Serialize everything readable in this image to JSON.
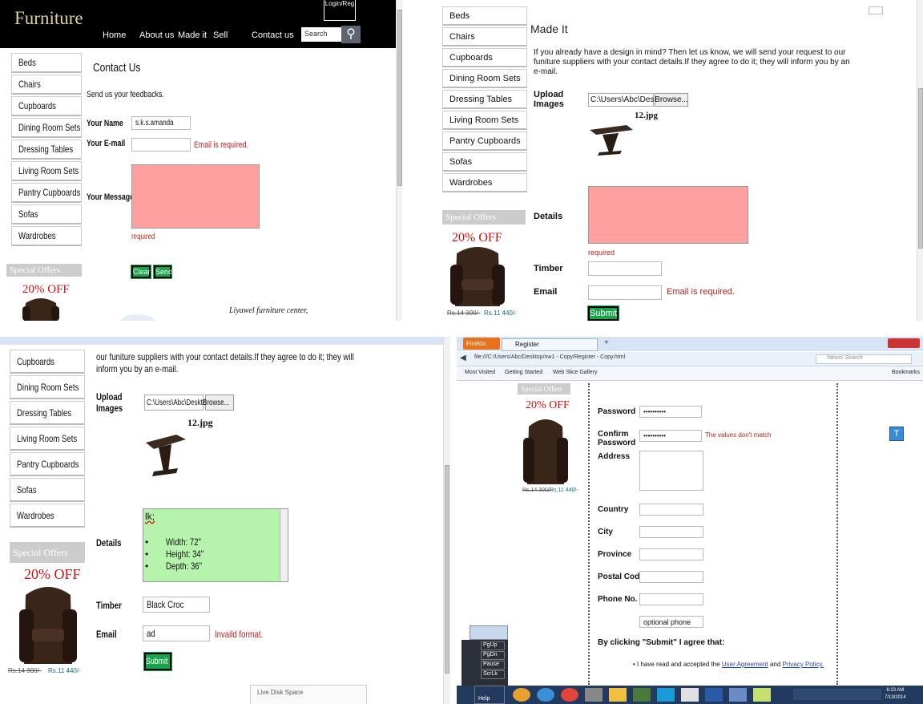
{
  "p1": {
    "logo": "Furniture",
    "nav": [
      "Home",
      "About us",
      "Made it",
      "Sell",
      "Contact us"
    ],
    "search_placeholder": "Search",
    "login": "Login/Reg",
    "sidebar": [
      "Beds",
      "Chairs",
      "Cupboards",
      "Dining Room Sets",
      "Dressing Tables",
      "Living Room Sets",
      "Pantry Cupboards",
      "Sofas",
      "Wardrobes"
    ],
    "special": "Special Offers",
    "offer": "20% OFF",
    "title": "Contact Us",
    "intro": "Send us your feedbacks.",
    "name_label": "Your Name",
    "name_value": "s.k.s.amanda",
    "email_label": "Your E-mail",
    "email_error": "Email is required.",
    "message_label": "Your Message",
    "required": "required",
    "clear": "Clear",
    "send": "Send",
    "footer": "Liyawel furniture center,"
  },
  "p2": {
    "sidebar": [
      "Beds",
      "Chairs",
      "Cupboards",
      "Dining Room Sets",
      "Dressing Tables",
      "Living Room Sets",
      "Pantry Cupboards",
      "Sofas",
      "Wardrobes"
    ],
    "special": "Special Offers",
    "offer": "20% OFF",
    "old_price": "Rs.14 300/-",
    "new_price": "Rs.11 440/-",
    "title": "Made It",
    "intro": "If you already have a design in mind? Then let us know, we will send your request to our funiture suppliers with your contact details.If they agree to do it; they will inform you by an e-mail.",
    "upload_label": "Upload Images",
    "file_path": "C:\\Users\\Abc\\Desktop\\",
    "browse": "Browse...",
    "file_name": "12.jpg",
    "details_label": "Details",
    "required": "required",
    "timber_label": "Timber",
    "email_label": "Email",
    "email_error": "Email is required.",
    "submit": "Submit"
  },
  "p3": {
    "sidebar": [
      "Cupboards",
      "Dining Room Sets",
      "Dressing Tables",
      "Living Room Sets",
      "Pantry Cupboards",
      "Sofas",
      "Wardrobes"
    ],
    "special": "Special Offers",
    "offer": "20% OFF",
    "old_price": "Rs.14 300/-",
    "new_price": "Rs.11 440/-",
    "intro": "our funiture suppliers with your contact details.If they agree to do it; they will inform you by an e-mail.",
    "upload_label": "Upload Images",
    "file_path": "C:\\Users\\Abc\\Desktop\\",
    "browse": "Browse...",
    "file_name": "12.jpg",
    "details_label": "Details",
    "details_head": "lk;",
    "details_items": [
      "Width: 72\"",
      "Height: 34\"",
      "Depth: 36\""
    ],
    "timber_label": "Timber",
    "timber_value": "Black Croc",
    "email_label": "Email",
    "email_value": "ad",
    "email_error": "Invaild format.",
    "submit": "Submit",
    "popup": "Live Disk Space"
  },
  "p4": {
    "browser": "Firefox",
    "tab": "Register",
    "url": "file:///C:/Users/Abc/Desktop/nw1 - Copy/Register - Copy.html",
    "search_placeholder": "Yahoo! Search",
    "bookmarks": [
      "Most Visited",
      "Getting Started",
      "Web Slice Gallery"
    ],
    "bookmarks_right": "Bookmarks",
    "special": "Special Offers",
    "offer": "20% OFF",
    "old_price": "Rs.14 300/-",
    "new_price": "Rs.11 440/-",
    "password_label": "Password",
    "password_value": "••••••••••",
    "confirm_label": "Confirm Password",
    "confirm_value": "••••••••••",
    "confirm_error": "The values don't match",
    "address_label": "Address",
    "country_label": "Country",
    "city_label": "City",
    "province_label": "Province",
    "postal_label": "Postal Code",
    "phone_label": "Phone No.",
    "optional_phone": "optional phone",
    "agree_text": "By clicking \"Submit\" I agree that:",
    "terms_prefix": "• I have read and accepted the",
    "user_agreement": "User Agreement",
    "and": "and",
    "privacy": "Privacy Policy.",
    "keys": [
      "Pause",
      "ScrLk",
      "Help",
      "PgUp",
      "PgDn"
    ],
    "clock": "6:23 AM",
    "date": "7/13/2014"
  }
}
